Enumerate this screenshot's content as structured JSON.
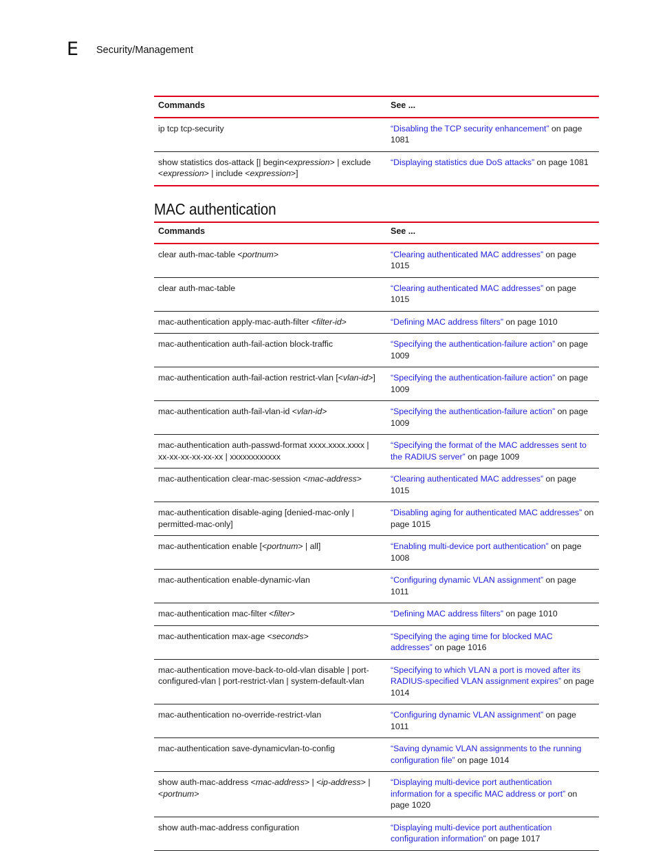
{
  "header": {
    "chapter_letter": "E",
    "chapter_title": "Security/Management"
  },
  "table1": {
    "columns": [
      "Commands",
      "See ..."
    ],
    "rows": [
      {
        "cmd": [
          {
            "t": "ip tcp tcp-security"
          }
        ],
        "link": "“Disabling the TCP security enhancement”",
        "suffix": " on page 1081"
      },
      {
        "cmd": [
          {
            "t": "show statistics dos-attack [| begin<"
          },
          {
            "t": "expression",
            "i": true
          },
          {
            "t": "> | exclude <"
          },
          {
            "t": "expression",
            "i": true
          },
          {
            "t": "> | include <"
          },
          {
            "t": "expression",
            "i": true
          },
          {
            "t": ">]"
          }
        ],
        "link": "“Displaying statistics due DoS attacks”",
        "suffix": " on page 1081"
      }
    ]
  },
  "section": {
    "title": "MAC authentication"
  },
  "table2": {
    "columns": [
      "Commands",
      "See ..."
    ],
    "rows": [
      {
        "cmd": [
          {
            "t": "clear auth-mac-table <"
          },
          {
            "t": "portnum",
            "i": true
          },
          {
            "t": ">"
          }
        ],
        "link": "“Clearing authenticated MAC addresses”",
        "suffix": " on page 1015"
      },
      {
        "cmd": [
          {
            "t": "clear auth-mac-table"
          }
        ],
        "link": "“Clearing authenticated MAC addresses”",
        "suffix": " on page 1015"
      },
      {
        "cmd": [
          {
            "t": "mac-authentication apply-mac-auth-filter <"
          },
          {
            "t": "filter-id",
            "i": true
          },
          {
            "t": ">"
          }
        ],
        "link": "“Defining MAC address filters”",
        "suffix": " on page 1010"
      },
      {
        "cmd": [
          {
            "t": "mac-authentication auth-fail-action block-traffic"
          }
        ],
        "link": "“Specifying the authentication-failure action”",
        "suffix": " on page 1009"
      },
      {
        "cmd": [
          {
            "t": "mac-authentication auth-fail-action restrict-vlan [<"
          },
          {
            "t": "vlan-id",
            "i": true
          },
          {
            "t": ">]"
          }
        ],
        "link": "“Specifying the authentication-failure action”",
        "suffix": " on page 1009"
      },
      {
        "cmd": [
          {
            "t": "mac-authentication auth-fail-vlan-id <"
          },
          {
            "t": "vlan-id",
            "i": true
          },
          {
            "t": ">"
          }
        ],
        "link": "“Specifying the authentication-failure action”",
        "suffix": " on page 1009"
      },
      {
        "cmd": [
          {
            "t": "mac-authentication auth-passwd-format xxxx.xxxx.xxxx | xx-xx-xx-xx-xx-xx | xxxxxxxxxxxx"
          }
        ],
        "link": "“Specifying the format of the MAC addresses sent to the RADIUS server”",
        "suffix": " on page 1009"
      },
      {
        "cmd": [
          {
            "t": "mac-authentication clear-mac-session <"
          },
          {
            "t": "mac-address",
            "i": true
          },
          {
            "t": ">"
          }
        ],
        "link": "“Clearing authenticated MAC addresses”",
        "suffix": " on page 1015"
      },
      {
        "cmd": [
          {
            "t": "mac-authentication disable-aging [denied-mac-only | permitted-mac-only]"
          }
        ],
        "link": "“Disabling aging for authenticated MAC addresses”",
        "suffix": " on page 1015"
      },
      {
        "cmd": [
          {
            "t": "mac-authentication enable [<"
          },
          {
            "t": "portnum",
            "i": true
          },
          {
            "t": "> | all]"
          }
        ],
        "link": "“Enabling multi-device port authentication”",
        "suffix": " on page 1008"
      },
      {
        "cmd": [
          {
            "t": "mac-authentication enable-dynamic-vlan"
          }
        ],
        "link": "“Configuring dynamic VLAN assignment”",
        "suffix": " on page 1011"
      },
      {
        "cmd": [
          {
            "t": "mac-authentication mac-filter <"
          },
          {
            "t": "filter",
            "i": true
          },
          {
            "t": ">"
          }
        ],
        "link": "“Defining MAC address filters”",
        "suffix": " on page 1010"
      },
      {
        "cmd": [
          {
            "t": "mac-authentication max-age <"
          },
          {
            "t": "seconds",
            "i": true
          },
          {
            "t": ">"
          }
        ],
        "link": "“Specifying the aging time for blocked MAC addresses”",
        "suffix": " on page 1016"
      },
      {
        "cmd": [
          {
            "t": "mac-authentication move-back-to-old-vlan disable | port-configured-vlan | port-restrict-vlan | system-default-vlan"
          }
        ],
        "link": "“Specifying to which VLAN a port is moved after its RADIUS-specified VLAN assignment expires”",
        "suffix": " on page 1014"
      },
      {
        "cmd": [
          {
            "t": "mac-authentication no-override-restrict-vlan"
          }
        ],
        "link": "“Configuring dynamic VLAN assignment”",
        "suffix": " on page 1011"
      },
      {
        "cmd": [
          {
            "t": "mac-authentication save-dynamicvlan-to-config"
          }
        ],
        "link": "“Saving dynamic VLAN assignments to the running configuration file”",
        "suffix": " on page 1014"
      },
      {
        "cmd": [
          {
            "t": "show auth-mac-address <"
          },
          {
            "t": "mac-address",
            "i": true
          },
          {
            "t": "> | <"
          },
          {
            "t": "ip-address",
            "i": true
          },
          {
            "t": "> | <"
          },
          {
            "t": "portnum",
            "i": true
          },
          {
            "t": ">"
          }
        ],
        "link": "“Displaying multi-device port authentication information for a specific MAC address or port”",
        "suffix": " on page 1020"
      },
      {
        "cmd": [
          {
            "t": "show auth-mac-address configuration"
          }
        ],
        "link": "“Displaying multi-device port authentication configuration information”",
        "suffix": " on page 1017"
      }
    ]
  }
}
